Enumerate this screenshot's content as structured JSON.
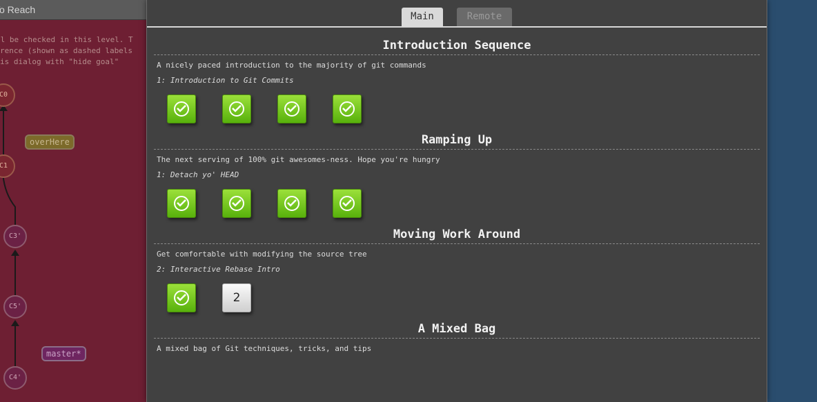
{
  "background": {
    "header_title": "To Reach",
    "description": "ll be checked in this level. T\nrence (shown as dashed labels\nis dialog with \"hide goal\"",
    "nodes": [
      "C0",
      "C1",
      "C3'",
      "C5'",
      "C4'"
    ],
    "branches": {
      "overhere": "overHere",
      "master": "master*"
    }
  },
  "tabs": {
    "main": "Main",
    "remote": "Remote"
  },
  "sections": [
    {
      "title": "Introduction Sequence",
      "description": "A nicely paced introduction to the majority of git commands",
      "subtitle": "1: Introduction to Git Commits",
      "levels": [
        {
          "state": "complete"
        },
        {
          "state": "complete"
        },
        {
          "state": "complete"
        },
        {
          "state": "complete"
        }
      ]
    },
    {
      "title": "Ramping Up",
      "description": "The next serving of 100% git awesomes-ness. Hope you're hungry",
      "subtitle": "1: Detach yo' HEAD",
      "levels": [
        {
          "state": "complete"
        },
        {
          "state": "complete"
        },
        {
          "state": "complete"
        },
        {
          "state": "complete"
        }
      ]
    },
    {
      "title": "Moving Work Around",
      "description": "Get comfortable with modifying the source tree",
      "subtitle": "2: Interactive Rebase Intro",
      "levels": [
        {
          "state": "complete"
        },
        {
          "state": "incomplete",
          "label": "2"
        }
      ]
    },
    {
      "title": "A Mixed Bag",
      "description": "A mixed bag of Git techniques, tricks, and tips"
    }
  ],
  "colors": {
    "dialog_bg": "#414141",
    "complete_green": "#6cc11a",
    "page_bg": "#2a4d6e",
    "goal_bg": "#6e1f33"
  }
}
